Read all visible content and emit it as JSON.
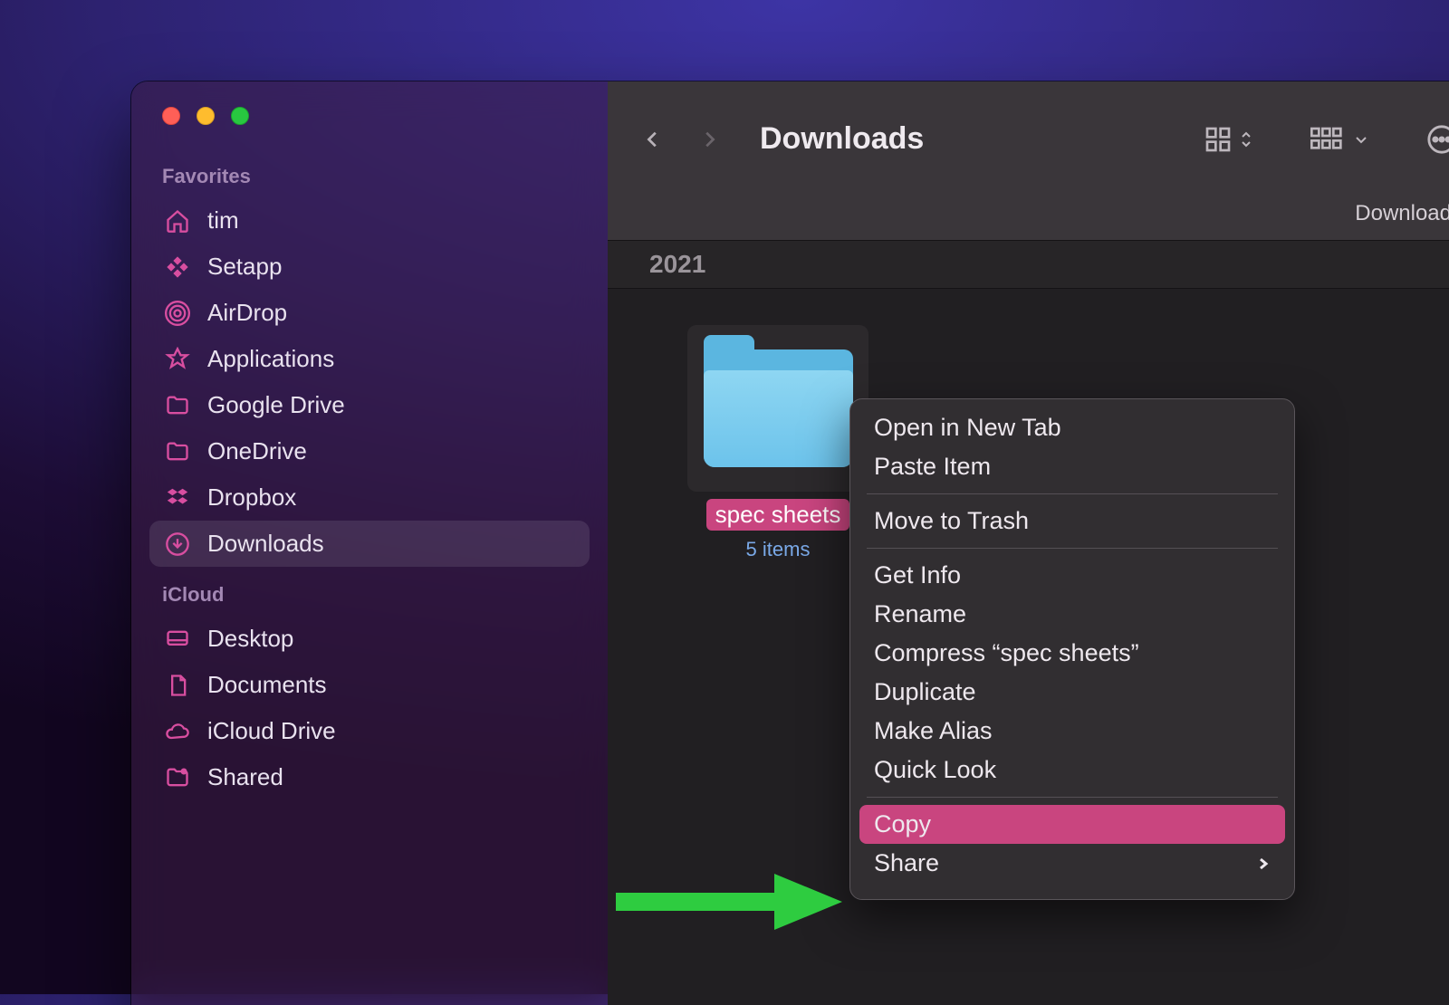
{
  "window": {
    "title": "Downloads",
    "path_label": "Downloads",
    "year_header": "2021"
  },
  "sidebar": {
    "sections": [
      {
        "header": "Favorites",
        "items": [
          {
            "icon": "home-icon",
            "label": "tim"
          },
          {
            "icon": "setapp-icon",
            "label": "Setapp"
          },
          {
            "icon": "airdrop-icon",
            "label": "AirDrop"
          },
          {
            "icon": "applications-icon",
            "label": "Applications"
          },
          {
            "icon": "folder-icon",
            "label": "Google Drive"
          },
          {
            "icon": "folder-icon",
            "label": "OneDrive"
          },
          {
            "icon": "dropbox-icon",
            "label": "Dropbox"
          },
          {
            "icon": "downloads-icon",
            "label": "Downloads",
            "active": true
          }
        ]
      },
      {
        "header": "iCloud",
        "items": [
          {
            "icon": "desktop-icon",
            "label": "Desktop"
          },
          {
            "icon": "documents-icon",
            "label": "Documents"
          },
          {
            "icon": "icloud-icon",
            "label": "iCloud Drive"
          },
          {
            "icon": "shared-icon",
            "label": "Shared"
          }
        ]
      }
    ]
  },
  "folder": {
    "name": "spec sheets",
    "subtitle": "5 items"
  },
  "context_menu": {
    "items": [
      {
        "label": "Open in New Tab"
      },
      {
        "label": "Paste Item"
      },
      {
        "sep": true
      },
      {
        "label": "Move to Trash"
      },
      {
        "sep": true
      },
      {
        "label": "Get Info"
      },
      {
        "label": "Rename"
      },
      {
        "label": "Compress “spec sheets”"
      },
      {
        "label": "Duplicate"
      },
      {
        "label": "Make Alias"
      },
      {
        "label": "Quick Look"
      },
      {
        "sep": true
      },
      {
        "label": "Copy",
        "highlight": true
      },
      {
        "label": "Share",
        "submenu": true
      }
    ]
  },
  "colors": {
    "accent": "#d84ea0",
    "highlight": "#c9457f",
    "annotation": "#2ecc40"
  }
}
